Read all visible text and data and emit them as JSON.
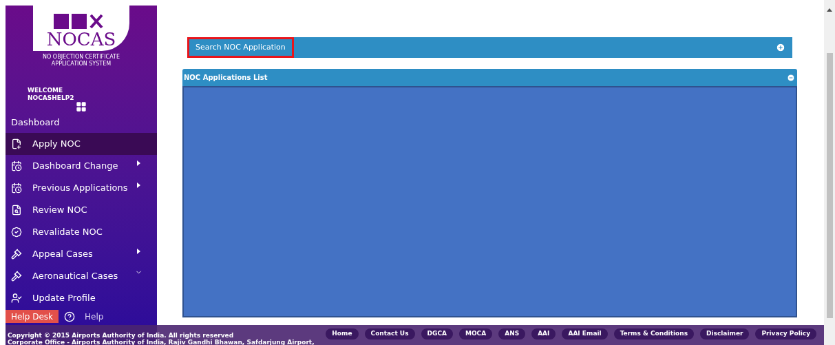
{
  "sidebar": {
    "logo_text": "NOCAS",
    "logo_subtitle": "NO OBJECTION CERTIFICATE APPLICATION SYSTEM",
    "welcome": "WELCOME",
    "username": "NOCASHELP2",
    "dashboard_label": "Dashboard",
    "items": [
      {
        "label": "Apply NOC",
        "selected": true,
        "kind": "plain"
      },
      {
        "label": "Dashboard Change",
        "selected": false,
        "kind": "submenu"
      },
      {
        "label": "Previous Applications",
        "selected": false,
        "kind": "submenu"
      },
      {
        "label": "Review NOC",
        "selected": false,
        "kind": "plain"
      },
      {
        "label": "Revalidate NOC",
        "selected": false,
        "kind": "plain"
      },
      {
        "label": "Appeal Cases",
        "selected": false,
        "kind": "submenu"
      },
      {
        "label": "Aeronautical Cases",
        "selected": false,
        "kind": "dropdown"
      },
      {
        "label": "Update Profile",
        "selected": false,
        "kind": "plain"
      }
    ],
    "help_desk": "Help Desk",
    "help": "Help"
  },
  "search_panel": {
    "title": "Search NOC Application",
    "expanded": false,
    "highlighted": true
  },
  "list_panel": {
    "title": "NOC Applications List",
    "expanded": true
  },
  "footer": {
    "copyright": "Copyright © 2015 Airports Authority of India. All rights reserved",
    "address": "Corporate Office - Airports Authority of India, Rajiv Gandhi Bhawan, Safdarjung Airport,",
    "links": [
      "Home",
      "Contact Us",
      "DGCA",
      "MOCA",
      "ANS",
      "AAI",
      "AAI Email",
      "Terms & Conditions",
      "Disclaimer",
      "Privacy Policy"
    ]
  }
}
